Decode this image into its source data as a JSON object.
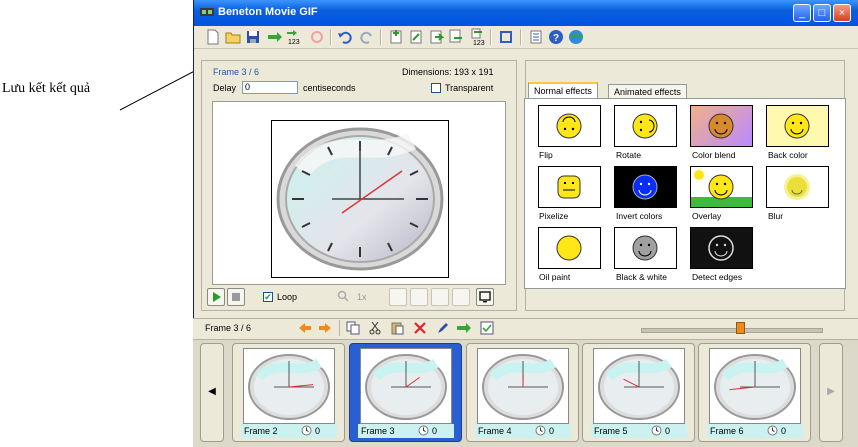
{
  "annotation": {
    "text": "Lưu kết kết quả"
  },
  "window": {
    "title": "Beneton Movie GIF"
  },
  "colors": {
    "titlebar": "#0054e3",
    "selected_frame": "#2a5fd1",
    "label_bg": "#cbf2f0"
  },
  "toolbar": {
    "icons": [
      "new-file-icon",
      "open-folder-icon",
      "save-icon",
      "export-icon",
      "export-numbered-icon",
      "loop-disabled-icon",
      "undo-icon",
      "redo-icon",
      "insert-frame-icon",
      "edit-frame-icon",
      "import-icon",
      "import-multi-icon",
      "import-numbered-icon",
      "resize-icon",
      "properties-icon",
      "help-icon",
      "web-icon"
    ]
  },
  "frame_panel": {
    "frame_info": "Frame 3 / 6",
    "dimensions": "Dimensions: 193 x 191",
    "delay_label": "Delay",
    "delay_value": "0",
    "delay_unit": "centiseconds",
    "transparent_label": "Transparent",
    "loop_label": "Loop",
    "zoom": "1x"
  },
  "tabs": [
    {
      "label": "Normal effects",
      "active": true
    },
    {
      "label": "Animated effects",
      "active": false
    }
  ],
  "effects": [
    {
      "label": "Flip"
    },
    {
      "label": "Rotate"
    },
    {
      "label": "Color blend"
    },
    {
      "label": "Back color"
    },
    {
      "label": "Pixelize"
    },
    {
      "label": "Invert colors"
    },
    {
      "label": "Overlay"
    },
    {
      "label": "Blur"
    },
    {
      "label": "Oil paint"
    },
    {
      "label": "Black & white"
    },
    {
      "label": "Detect edges"
    }
  ],
  "framebar": {
    "info": "Frame 3 / 6",
    "slider_value": 0.55
  },
  "frames": [
    {
      "label": "Frame 2",
      "delay": "0"
    },
    {
      "label": "Frame 3",
      "delay": "0",
      "selected": true
    },
    {
      "label": "Frame 4",
      "delay": "0"
    },
    {
      "label": "Frame 5",
      "delay": "0"
    },
    {
      "label": "Frame 6",
      "delay": "0"
    }
  ]
}
